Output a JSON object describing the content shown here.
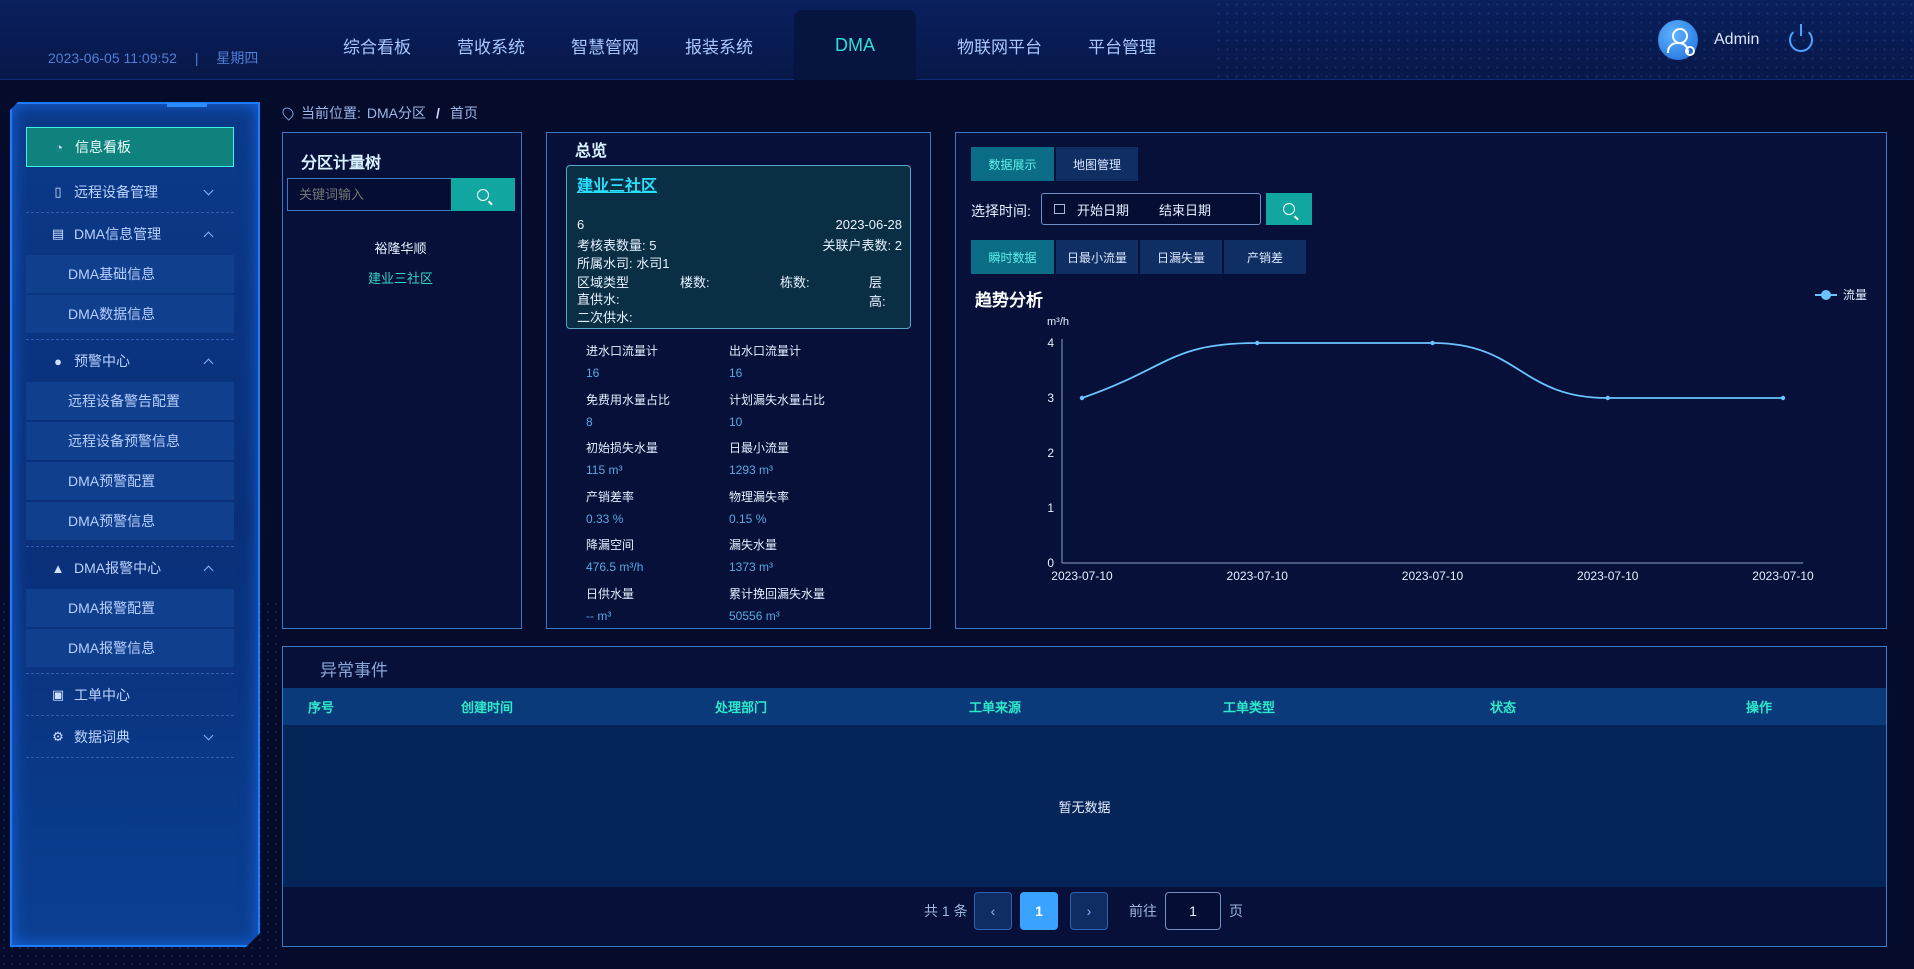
{
  "header": {
    "datetime": "2023-06-05 11:09:52",
    "weekday": "星期四",
    "nav": [
      "综合看板",
      "营收系统",
      "智慧管网",
      "报装系统",
      "DMA",
      "物联网平台",
      "平台管理"
    ],
    "active_nav": "DMA",
    "username": "Admin"
  },
  "sidebar": {
    "items": [
      {
        "label": "信息看板",
        "icon": "dashboard-icon"
      },
      {
        "label": "远程设备管理",
        "icon": "tablet-icon"
      },
      {
        "label": "DMA信息管理",
        "icon": "book-icon"
      },
      {
        "label": "DMA基础信息"
      },
      {
        "label": "DMA数据信息"
      },
      {
        "label": "预警中心",
        "icon": "alert-circle-icon"
      },
      {
        "label": "远程设备警告配置"
      },
      {
        "label": "远程设备预警信息"
      },
      {
        "label": "DMA预警配置"
      },
      {
        "label": "DMA预警信息"
      },
      {
        "label": "DMA报警中心",
        "icon": "warning-triangle-icon"
      },
      {
        "label": "DMA报警配置"
      },
      {
        "label": "DMA报警信息"
      },
      {
        "label": "工单中心",
        "icon": "clipboard-icon"
      },
      {
        "label": "数据词典",
        "icon": "gear-icon"
      }
    ]
  },
  "breadcrumb": {
    "prefix": "当前位置:",
    "items": [
      "DMA分区",
      "首页"
    ]
  },
  "tree": {
    "title": "分区计量树",
    "search_placeholder": "关键词输入",
    "nodes": [
      "裕隆华顺",
      "建业三社区"
    ]
  },
  "overview": {
    "title": "总览",
    "card": {
      "name": "建业三社区",
      "id": "6",
      "date": "2023-06-28",
      "check_meters": "考核表数量: 5",
      "linked_users": "关联户表数: 2",
      "water_company": "所属水司: 水司1",
      "area_type": "区域类型",
      "buildings": "楼数:",
      "blocks": "栋数:",
      "floors": "层高:",
      "direct_supply": "直供水:",
      "secondary_supply": "二次供水:"
    },
    "stats": [
      {
        "label": "进水口流量计",
        "value": "16"
      },
      {
        "label": "出水口流量计",
        "value": "16"
      },
      {
        "label": "免费用水量占比",
        "value": "8"
      },
      {
        "label": "计划漏失水量占比",
        "value": "10"
      },
      {
        "label": "初始损失水量",
        "value": "115 m³"
      },
      {
        "label": "日最小流量",
        "value": "1293 m³"
      },
      {
        "label": "产销差率",
        "value": "0.33 %"
      },
      {
        "label": "物理漏失率",
        "value": "0.15 %"
      },
      {
        "label": "降漏空间",
        "value": "476.5 m³/h"
      },
      {
        "label": "漏失水量",
        "value": "1373 m³"
      },
      {
        "label": "日供水量",
        "value": "-- m³"
      },
      {
        "label": "累计挽回漏失水量",
        "value": "50556 m³"
      }
    ]
  },
  "analysis": {
    "top_tabs": [
      "数据展示",
      "地图管理"
    ],
    "time_label": "选择时间:",
    "start_placeholder": "开始日期",
    "end_placeholder": "结束日期",
    "sub_tabs": [
      "瞬时数据",
      "日最小流量",
      "日漏失量",
      "产销差"
    ],
    "title": "趋势分析",
    "unit": "m³/h",
    "legend": "流量"
  },
  "chart_data": {
    "type": "line",
    "title": "趋势分析",
    "ylabel": "m³/h",
    "x": [
      "2023-07-10",
      "2023-07-10",
      "2023-07-10",
      "2023-07-10",
      "2023-07-10"
    ],
    "series": [
      {
        "name": "流量",
        "values": [
          3,
          4,
          4,
          3,
          3
        ]
      }
    ],
    "ylim": [
      0,
      4
    ],
    "yticks": [
      "0",
      "1",
      "2",
      "3",
      "4"
    ],
    "grid": false,
    "smooth": true,
    "legend_position": "top-right",
    "color": "#6bc4ff"
  },
  "events": {
    "title": "异常事件",
    "columns": [
      "序号",
      "创建时间",
      "处理部门",
      "工单来源",
      "工单类型",
      "状态",
      "操作"
    ],
    "empty_text": "暂无数据",
    "total": "共 1 条",
    "current_page": "1",
    "goto_label": "前往",
    "page_value": "1",
    "page_suffix": "页"
  }
}
